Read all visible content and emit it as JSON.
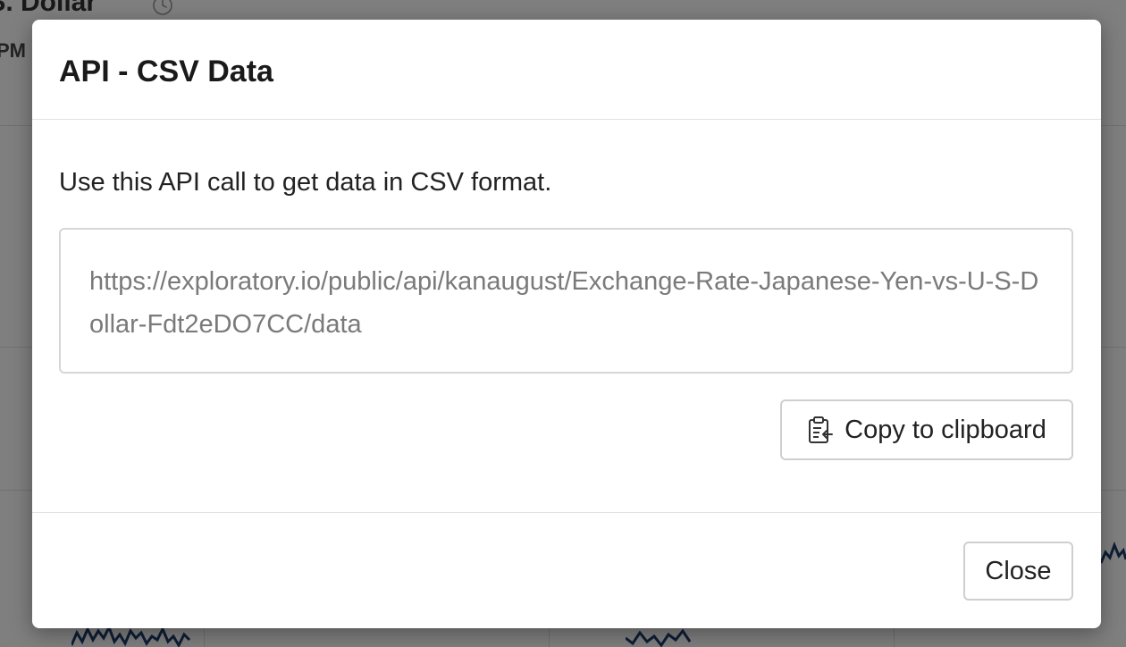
{
  "background": {
    "title": ".S. Dollar",
    "time_label": "PM",
    "history_icon": "clock-history-icon",
    "sparkline_color": "#1f3d6b"
  },
  "modal": {
    "title": "API - CSV Data",
    "description": "Use this API call to get data in CSV format.",
    "api_url": "https://exploratory.io/public/api/kanaugust/Exchange-Rate-Japanese-Yen-vs-U-S-Dollar-Fdt2eDO7CC/data",
    "copy_button_label": "Copy to clipboard",
    "copy_icon": "clipboard-icon",
    "close_button_label": "Close"
  }
}
